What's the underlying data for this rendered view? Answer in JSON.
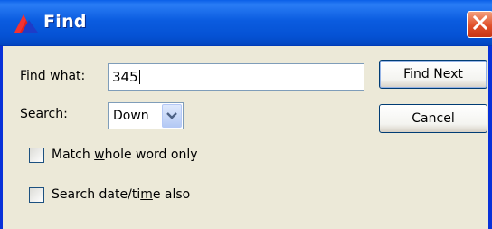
{
  "window": {
    "title": "Find",
    "accent_color": "#0a5fe8",
    "close_color": "#e0502a"
  },
  "find": {
    "label": "Find what:",
    "value": "345"
  },
  "search": {
    "label": "Search:",
    "selected": "Down"
  },
  "buttons": {
    "find_next": "Find Next",
    "cancel": "Cancel"
  },
  "options": {
    "match_whole_word": {
      "pre": "Match ",
      "accel": "w",
      "post": "hole word only",
      "checked": false
    },
    "search_datetime": {
      "pre": "Search date/ti",
      "accel": "m",
      "post": "e also",
      "checked": false
    }
  },
  "icons": {
    "app": "app-logo-icon",
    "close": "close-icon",
    "dropdown": "chevron-down-icon"
  }
}
